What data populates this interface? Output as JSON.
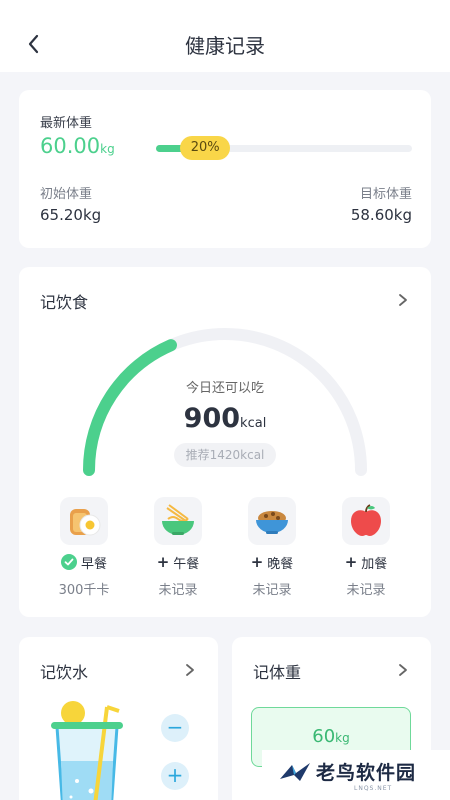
{
  "header": {
    "title": "健康记录"
  },
  "weight": {
    "latest_label": "最新体重",
    "latest_value": "60.00",
    "latest_unit": "kg",
    "progress": 0.2,
    "progress_label": "20%",
    "start_label": "初始体重",
    "start_value": "65.20kg",
    "target_label": "目标体重",
    "target_value": "58.60kg"
  },
  "diet": {
    "title": "记饮食",
    "remain_label": "今日还可以吃",
    "remain_value": "900",
    "remain_unit": "kcal",
    "recommend": "推荐1420kcal",
    "consumed_fraction": 0.37,
    "meals": [
      {
        "name": "早餐",
        "status": "300千卡",
        "recorded": true,
        "icon": "toast-egg-icon"
      },
      {
        "name": "午餐",
        "status": "未记录",
        "recorded": false,
        "icon": "noodle-bowl-icon"
      },
      {
        "name": "晚餐",
        "status": "未记录",
        "recorded": false,
        "icon": "rice-bowl-icon"
      },
      {
        "name": "加餐",
        "status": "未记录",
        "recorded": false,
        "icon": "apple-icon"
      }
    ],
    "add_mark": "+"
  },
  "water": {
    "title": "记饮水",
    "minus": "−",
    "plus": "+"
  },
  "body_weight": {
    "title": "记体重",
    "value": "60",
    "unit": "kg"
  },
  "watermark": {
    "text": "老鸟软件园",
    "url": "LNQS.NET"
  },
  "colors": {
    "accent_green": "#4cd08d",
    "badge_yellow": "#f9d648",
    "water_blue": "#2ba7dc"
  }
}
